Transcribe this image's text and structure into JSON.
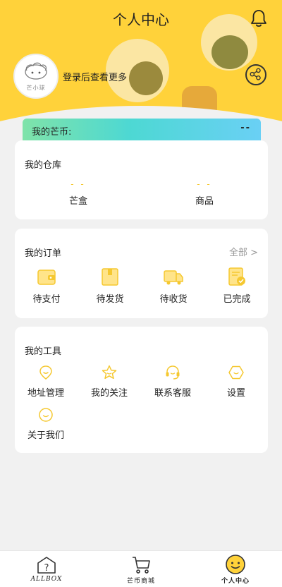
{
  "header": {
    "title": "个人中心",
    "bell_icon": "bell-icon"
  },
  "profile": {
    "avatar_label": "芒小球",
    "login_prompt": "登录后查看更多",
    "share_icon": "share-icon"
  },
  "coins": {
    "label": "我的芒币:",
    "value": "--"
  },
  "warehouse": {
    "title": "我的仓库",
    "stats": [
      {
        "value": "- -",
        "label": "芒盒"
      },
      {
        "value": "- -",
        "label": "商品"
      }
    ]
  },
  "orders": {
    "title": "我的订单",
    "all_link": "全部 >",
    "items": [
      {
        "label": "待支付",
        "icon": "wallet-icon"
      },
      {
        "label": "待发货",
        "icon": "package-icon"
      },
      {
        "label": "待收货",
        "icon": "truck-icon"
      },
      {
        "label": "已完成",
        "icon": "completed-icon"
      }
    ]
  },
  "tools": {
    "title": "我的工具",
    "items": [
      {
        "label": "地址管理",
        "icon": "location-icon"
      },
      {
        "label": "我的关注",
        "icon": "star-icon"
      },
      {
        "label": "联系客服",
        "icon": "headset-icon"
      },
      {
        "label": "设置",
        "icon": "settings-icon"
      },
      {
        "label": "关于我们",
        "icon": "smile-icon"
      }
    ]
  },
  "tabbar": {
    "items": [
      {
        "label": "ALLBOX",
        "icon": "box-icon",
        "active": false
      },
      {
        "label": "芒币商城",
        "icon": "cart-icon",
        "active": false
      },
      {
        "label": "个人中心",
        "icon": "smiley-face-icon",
        "active": true
      }
    ]
  },
  "colors": {
    "accent": "#ffd23a",
    "icon_yellow": "#f5c830",
    "page_bg": "#f1f1f1"
  }
}
